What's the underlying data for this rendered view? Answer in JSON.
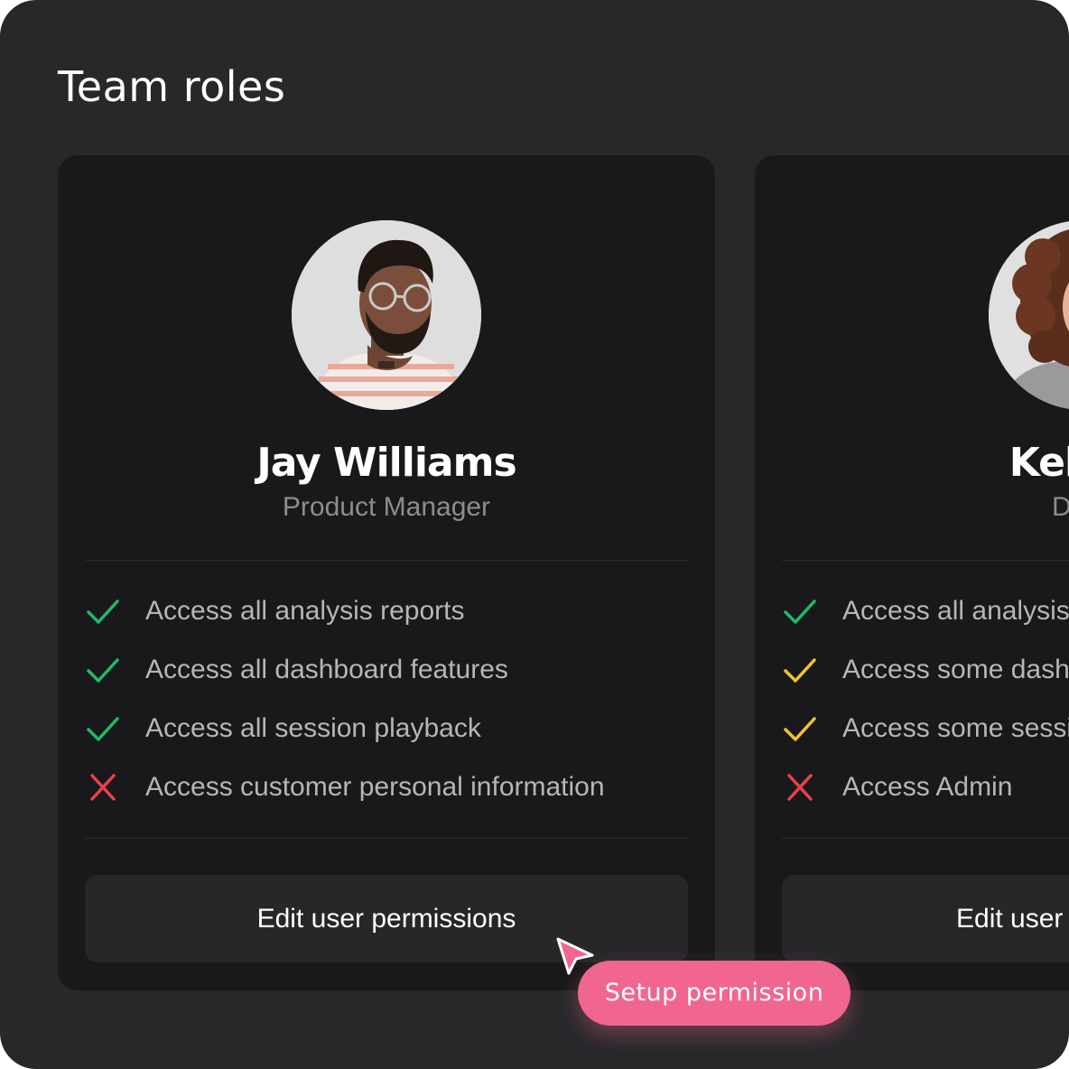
{
  "page": {
    "title": "Team roles"
  },
  "colors": {
    "panel_bg": "#28282b",
    "card_bg": "#19191b",
    "allowed": "#1fba6a",
    "partial": "#f2c230",
    "denied": "#e8414d",
    "accent": "#f1668f"
  },
  "cards": [
    {
      "name": "Jay Williams",
      "role": "Product Manager",
      "avatar": "avatar-man-with-glasses-photo",
      "permissions": [
        {
          "label": "Access all analysis reports",
          "status": "allowed",
          "icon": "check-icon"
        },
        {
          "label": "Access all dashboard features",
          "status": "allowed",
          "icon": "check-icon"
        },
        {
          "label": "Access all session playback",
          "status": "allowed",
          "icon": "check-icon"
        },
        {
          "label": "Access customer personal information",
          "status": "denied",
          "icon": "x-icon"
        }
      ],
      "button_label": "Edit user permissions"
    },
    {
      "name": "Kelly V",
      "role": "Deve",
      "avatar": "avatar-woman-with-curly-hair-photo",
      "permissions": [
        {
          "label": "Access all analysis",
          "status": "allowed",
          "icon": "check-icon"
        },
        {
          "label": "Access some dash",
          "status": "partial",
          "icon": "check-icon"
        },
        {
          "label": "Access some sessi",
          "status": "partial",
          "icon": "check-icon"
        },
        {
          "label": "Access Admin",
          "status": "denied",
          "icon": "x-icon"
        }
      ],
      "button_label": "Edit user p"
    }
  ],
  "cursor": {
    "icon": "pointer-arrow-icon"
  },
  "tooltip": {
    "label": "Setup permission"
  }
}
